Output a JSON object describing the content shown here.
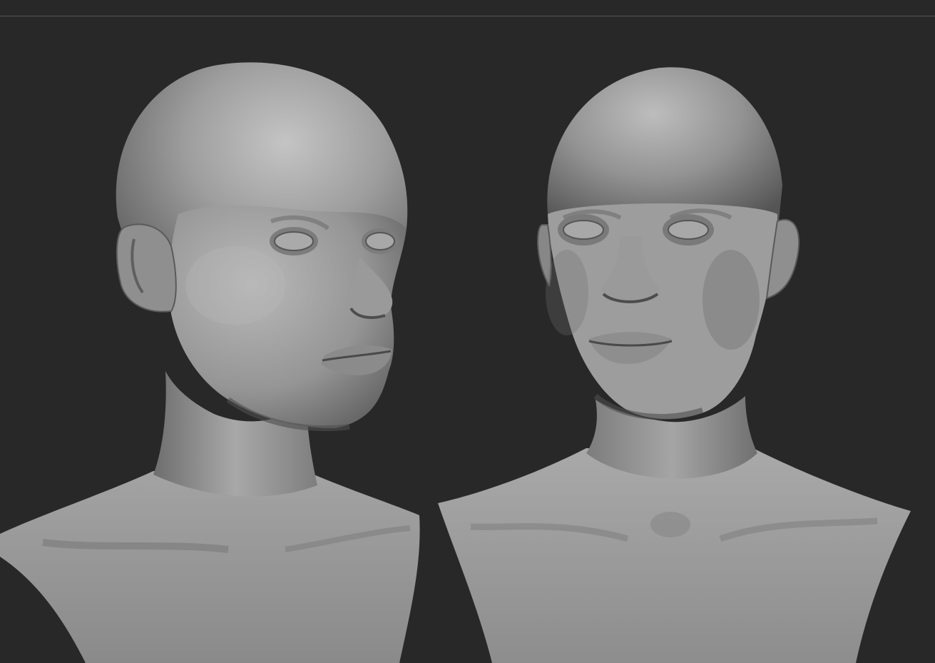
{
  "app": {
    "type": "3d-sculpt-viewport"
  },
  "viewport": {
    "background_color": "#282828",
    "divider_color": "#565656",
    "material_color": "#9a9a9a"
  },
  "models": [
    {
      "view": "three-quarter"
    },
    {
      "view": "front"
    }
  ]
}
